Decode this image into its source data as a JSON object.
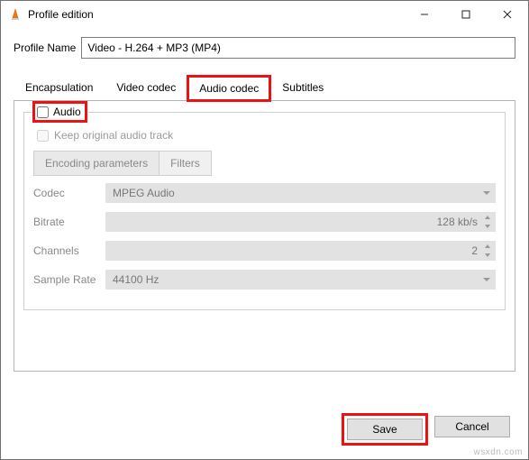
{
  "window": {
    "title": "Profile edition"
  },
  "profile": {
    "label": "Profile Name",
    "value": "Video - H.264 + MP3 (MP4)"
  },
  "tabs": {
    "encapsulation": "Encapsulation",
    "video": "Video codec",
    "audio": "Audio codec",
    "subtitles": "Subtitles"
  },
  "audio_group": {
    "legend": "Audio",
    "keep_original": "Keep original audio track"
  },
  "subtabs": {
    "encoding": "Encoding parameters",
    "filters": "Filters"
  },
  "params": {
    "codec": {
      "label": "Codec",
      "value": "MPEG Audio"
    },
    "bitrate": {
      "label": "Bitrate",
      "value": "128 kb/s"
    },
    "channels": {
      "label": "Channels",
      "value": "2"
    },
    "samplerate": {
      "label": "Sample Rate",
      "value": "44100 Hz"
    }
  },
  "footer": {
    "save": "Save",
    "cancel": "Cancel"
  },
  "watermark": "wsxdn.com"
}
